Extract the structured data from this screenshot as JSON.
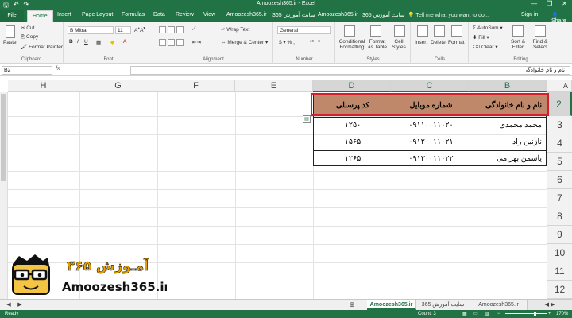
{
  "window": {
    "title": "Amoozesh365.ir - Excel",
    "minimize_glyph": "—",
    "restore_glyph": "❐",
    "close_glyph": "✕"
  },
  "tabs": {
    "file": "File",
    "items": [
      "Home",
      "Insert",
      "Page Layout",
      "Formulas",
      "Data",
      "Review",
      "View",
      "Amoozesh365.ir",
      "سایت آموزش 365",
      "Amoozesh365.ir",
      "سایت آموزش 365"
    ],
    "tell_me": "Tell me what you want to do...",
    "sign_in": "Sign in",
    "share": "Share"
  },
  "ribbon": {
    "clipboard": {
      "paste": "Paste",
      "cut": "Cut",
      "copy": "Copy",
      "format_painter": "Format Painter",
      "label": "Clipboard"
    },
    "font": {
      "name": "B Mitra",
      "size": "11",
      "label": "Font"
    },
    "alignment": {
      "wrap_text": "Wrap Text",
      "merge_center": "Merge & Center",
      "label": "Alignment"
    },
    "number": {
      "format": "General",
      "label": "Number"
    },
    "styles": {
      "conditional": "Conditional Formatting",
      "format_table": "Format as Table",
      "cell_styles": "Cell Styles",
      "label": "Styles"
    },
    "cells": {
      "insert": "Insert",
      "delete": "Delete",
      "format": "Format",
      "label": "Cells"
    },
    "editing": {
      "autosum": "AutoSum",
      "fill": "Fill",
      "clear": "Clear",
      "sort_filter": "Sort & Filter",
      "find_select": "Find & Select",
      "label": "Editing"
    }
  },
  "formula_bar": {
    "name_box": "B2",
    "fx": "fx",
    "content": "نام و نام خانوادگی"
  },
  "columns": [
    "H",
    "G",
    "F",
    "E",
    "D",
    "C",
    "B",
    "A"
  ],
  "rows": [
    "2",
    "3",
    "4",
    "5",
    "6",
    "7",
    "8",
    "9",
    "10",
    "11",
    "12"
  ],
  "table": {
    "headers": [
      "نام و نام خانوادگی",
      "شماره موبایل",
      "کد پرسنلی"
    ],
    "rows": [
      [
        "محمد محمدی",
        "۰۹۱۱۰۰۱۱۰۲۰",
        "۱۲۵۰"
      ],
      [
        "نازنین راد",
        "۰۹۱۲۰۰۱۱۰۲۱",
        "۱۵۶۵"
      ],
      [
        "یاسمن بهرامی",
        "۰۹۱۳۰۰۱۱۰۲۲",
        "۱۲۶۵"
      ]
    ]
  },
  "sheet_tabs": [
    "Amoozesh365.ir",
    "سایت آموزش 365",
    "Amoozesh365.ir"
  ],
  "status": {
    "ready": "Ready",
    "count": "Count: 3",
    "zoom": "170%"
  },
  "logo": {
    "text": "Amoozesh365.ir",
    "fa_text": "آمـوزش ۳۶۵"
  },
  "colors": {
    "excel_green": "#217346",
    "header_fill": "#c0886a",
    "selection_red": "#d0202e"
  }
}
